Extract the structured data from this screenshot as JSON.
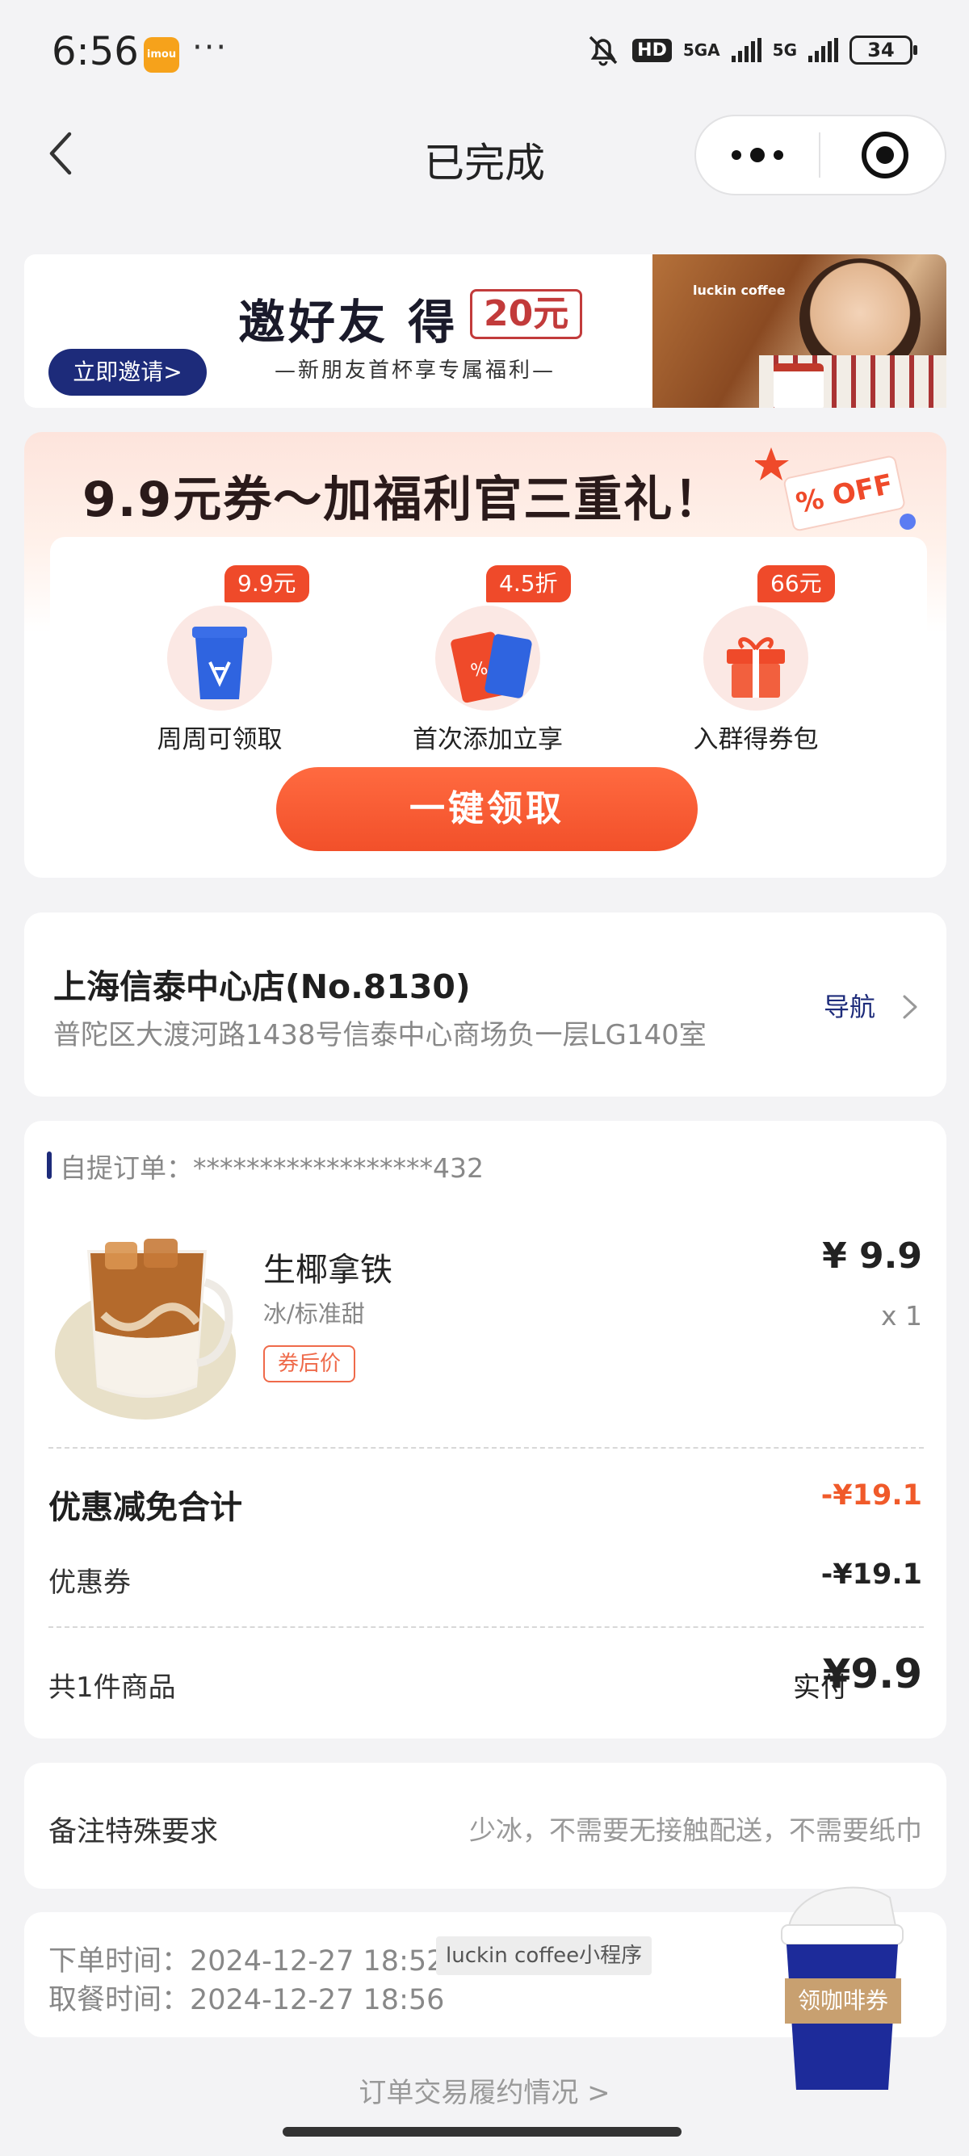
{
  "status_bar": {
    "time": "6:56",
    "app_badge": "imou",
    "dots": "···",
    "hd": "HD",
    "net1": "5GA",
    "net2": "5G",
    "battery": "34"
  },
  "nav": {
    "title": "已完成"
  },
  "invite_banner": {
    "button": "立即邀请>",
    "title": "邀好友 得",
    "amount": "20元",
    "subtitle": "—新朋友首杯享专属福利—",
    "photo_brand": "luckin coffee"
  },
  "promo": {
    "title": "9.9元券～加福利官三重礼！",
    "deco_text": "% OFF",
    "benefits": [
      {
        "tag": "9.9元",
        "label": "周周可领取",
        "icon": "coffee-cup-icon"
      },
      {
        "tag": "4.5折",
        "label": "首次添加立享",
        "icon": "coupon-tickets-icon"
      },
      {
        "tag": "66元",
        "label": "入群得券包",
        "icon": "gift-box-icon"
      }
    ],
    "claim_button": "一键领取"
  },
  "store": {
    "name": "上海信泰中心店(No.8130)",
    "address": "普陀区大渡河路1438号信泰中心商场负一层LG140室",
    "nav_label": "导航"
  },
  "order": {
    "id_label": "自提订单：******************432",
    "item": {
      "name": "生椰拿铁",
      "spec": "冰/标准甜",
      "tag": "券后价",
      "price": "¥ 9.9",
      "qty": "x 1"
    },
    "discount_total_label": "优惠减免合计",
    "discount_total_value": "-¥19.1",
    "coupon_label": "优惠券",
    "coupon_value": "-¥19.1",
    "count_label": "共1件商品",
    "paid_label": "实付",
    "paid_value": "¥9.9"
  },
  "remark": {
    "label": "备注特殊要求",
    "value": "少冰，不需要无接触配送，不需要纸巾"
  },
  "times": {
    "order_time": "下单时间：2024-12-27 18:52",
    "pickup_time": "取餐时间：2024-12-27 18:56",
    "source": "luckin coffee小程序"
  },
  "float_cup": {
    "label": "领咖啡券"
  },
  "footer": {
    "fulfillment_link": "订单交易履约情况 >"
  },
  "colors": {
    "brand_blue": "#1d2b7a",
    "accent_orange": "#f2502a",
    "page_bg": "#f3f3f5"
  }
}
